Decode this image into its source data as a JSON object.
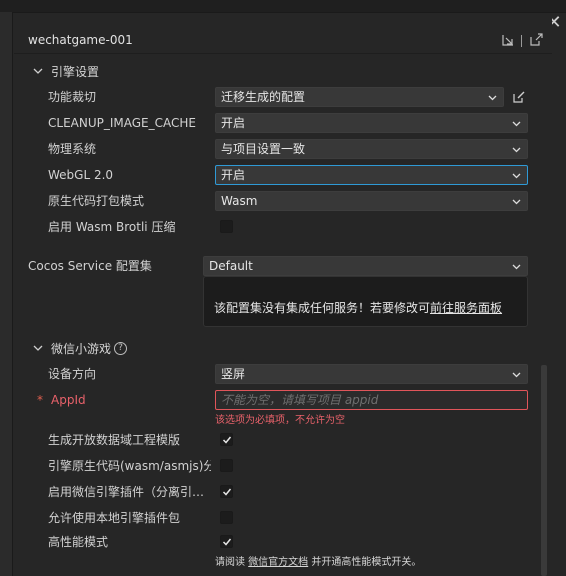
{
  "header": {
    "title": "wechatgame-001",
    "icons": [
      "export-icon",
      "external-link-icon"
    ]
  },
  "engine_section": {
    "title": "引擎设置",
    "rows": [
      {
        "label": "功能裁切",
        "value": "迁移生成的配置"
      },
      {
        "label": "CLEANUP_IMAGE_CACHE",
        "value": "开启"
      },
      {
        "label": "物理系统",
        "value": "与项目设置一致"
      },
      {
        "label": "WebGL 2.0",
        "value": "开启"
      },
      {
        "label": "原生代码打包模式",
        "value": "Wasm"
      },
      {
        "label": "启用 Wasm Brotli 压缩",
        "checked": false
      }
    ]
  },
  "cocos_service": {
    "label": "Cocos Service 配置集",
    "value": "Default",
    "info_text": "该配置集没有集成任何服务！若要修改可",
    "info_link": "前往服务面板"
  },
  "wechat_section": {
    "title": "微信小游戏",
    "help_glyph": "?",
    "orientation_label": "设备方向",
    "orientation_value": "竖屏",
    "appid_label": "AppId",
    "appid_required_star": "*",
    "appid_placeholder": "不能为空，请填写项目 appid",
    "appid_error": "该选项为必填项，不允许为空",
    "checks": [
      {
        "label": "生成开放数据域工程模版",
        "checked": true
      },
      {
        "label": "引擎原生代码(wasm/asmjs)分包",
        "checked": false
      },
      {
        "label": "启用微信引擎插件（分离引擎代码）",
        "checked": true
      },
      {
        "label": "允许使用本地引擎插件包",
        "checked": false
      },
      {
        "label": "高性能模式",
        "checked": true
      }
    ],
    "hint_prefix": "请阅读",
    "hint_link": "微信官方文档",
    "hint_suffix": "并开通高性能模式开关。"
  },
  "colors": {
    "accent": "#2f9ad6",
    "error": "#e0555a",
    "bg": "#262626"
  },
  "window": {
    "close_glyph": "✕"
  }
}
